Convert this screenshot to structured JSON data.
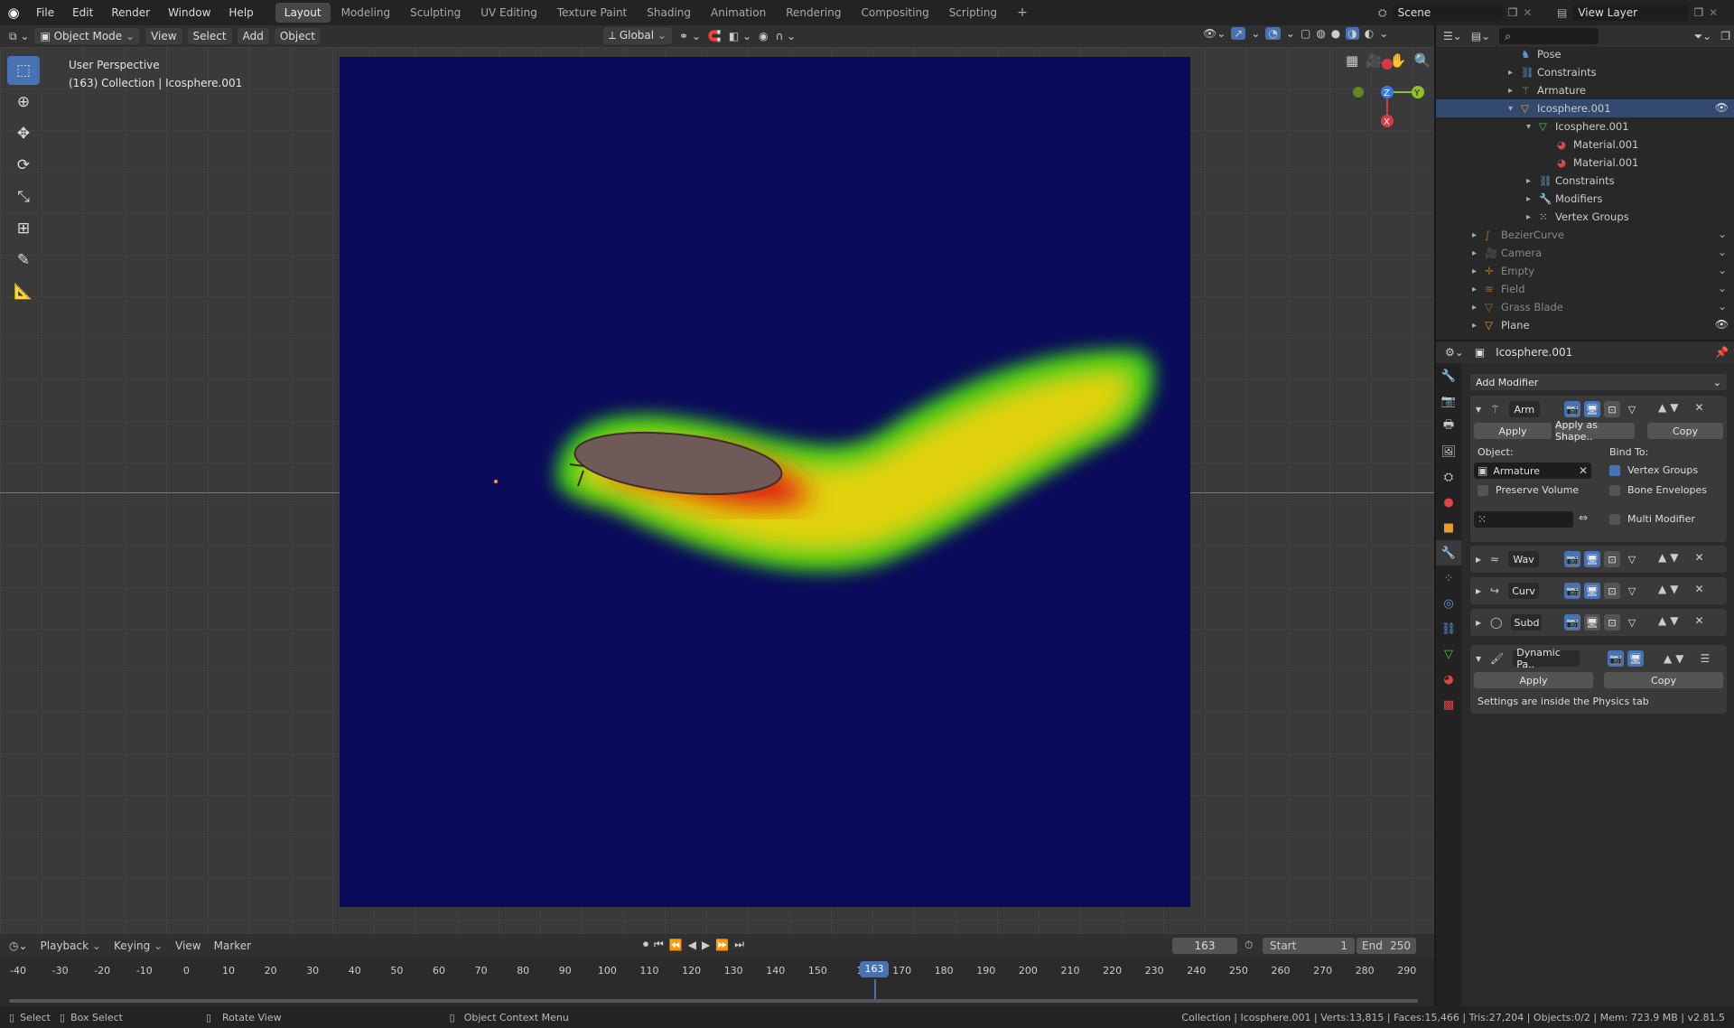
{
  "topbar": {
    "menus": [
      "File",
      "Edit",
      "Render",
      "Window",
      "Help"
    ],
    "workspaces": [
      "Layout",
      "Modeling",
      "Sculpting",
      "UV Editing",
      "Texture Paint",
      "Shading",
      "Animation",
      "Rendering",
      "Compositing",
      "Scripting"
    ],
    "active_workspace": "Layout",
    "add_tab": "+",
    "scene": "Scene",
    "view_layer": "View Layer"
  },
  "viewport_header": {
    "mode": "Object Mode",
    "menus": [
      "View",
      "Select",
      "Add",
      "Object"
    ],
    "orientation": "Global"
  },
  "viewport": {
    "line1": "User Perspective",
    "line2": "(163) Collection | Icosphere.001",
    "canvas_color": "#0a0a5a"
  },
  "outliner": {
    "search_placeholder": "",
    "rows": [
      {
        "label": "Pose",
        "icon": "pose-icon",
        "indent": 1,
        "muted": false
      },
      {
        "label": "Constraints",
        "icon": "constraint-icon",
        "indent": 1,
        "muted": false,
        "exp": "▸"
      },
      {
        "label": "Armature",
        "icon": "armature-icon",
        "indent": 1,
        "muted": false,
        "exp": "▸"
      },
      {
        "label": "Icosphere.001",
        "icon": "mesh-object-icon",
        "indent": 1,
        "muted": false,
        "exp": "▾",
        "highlight": true
      },
      {
        "label": "Icosphere.001",
        "icon": "mesh-data-icon",
        "indent": 2,
        "muted": false,
        "exp": "▾"
      },
      {
        "label": "Material.001",
        "icon": "material-icon",
        "indent": 3,
        "muted": false
      },
      {
        "label": "Material.001",
        "icon": "material-icon",
        "indent": 3,
        "muted": false
      },
      {
        "label": "Constraints",
        "icon": "constraint-icon",
        "indent": 2,
        "muted": false,
        "exp": "▸"
      },
      {
        "label": "Modifiers",
        "icon": "wrench-icon",
        "indent": 2,
        "muted": false,
        "exp": "▸"
      },
      {
        "label": "Vertex Groups",
        "icon": "vertex-groups-icon",
        "indent": 2,
        "muted": false,
        "exp": "▸"
      },
      {
        "label": "BezierCurve",
        "icon": "curve-icon",
        "indent": 0,
        "muted": true,
        "exp": "▸"
      },
      {
        "label": "Camera",
        "icon": "camera-icon",
        "indent": 0,
        "muted": true,
        "exp": "▸"
      },
      {
        "label": "Empty",
        "icon": "empty-icon",
        "indent": 0,
        "muted": true,
        "exp": "▸"
      },
      {
        "label": "Field",
        "icon": "field-icon",
        "indent": 0,
        "muted": true,
        "exp": "▸"
      },
      {
        "label": "Grass Blade",
        "icon": "mesh-object-icon",
        "indent": 0,
        "muted": true,
        "exp": "▸"
      },
      {
        "label": "Plane",
        "icon": "mesh-object-icon",
        "indent": 0,
        "muted": false,
        "exp": "▸"
      }
    ]
  },
  "properties": {
    "object_name": "Icosphere.001",
    "add_modifier": "Add Modifier",
    "armature_mod": {
      "name": "Arm",
      "apply": "Apply",
      "apply_shape": "Apply as Shape..",
      "copy": "Copy",
      "object_label": "Object:",
      "object_value": "Armature",
      "bind_to": "Bind To:",
      "vertex_groups": "Vertex Groups",
      "preserve_volume": "Preserve Volume",
      "bone_envelopes": "Bone Envelopes",
      "multi_modifier": "Multi Modifier"
    },
    "collapsed_mods": [
      {
        "name": "Wav",
        "icon": "wave-icon"
      },
      {
        "name": "Curv",
        "icon": "curve-mod-icon"
      },
      {
        "name": "Subd",
        "icon": "subsurf-icon"
      }
    ],
    "dynpaint": {
      "name": "Dynamic Pa..",
      "apply": "Apply",
      "copy": "Copy",
      "note": "Settings are inside the Physics tab"
    }
  },
  "timeline": {
    "menus": [
      "Playback",
      "Keying",
      "View",
      "Marker"
    ],
    "current_frame": "163",
    "start_label": "Start",
    "start": "1",
    "end_label": "End",
    "end": "250",
    "ticks": [
      "-40",
      "-30",
      "-20",
      "-10",
      "0",
      "10",
      "20",
      "30",
      "40",
      "50",
      "60",
      "70",
      "80",
      "90",
      "100",
      "110",
      "120",
      "130",
      "140",
      "150",
      "1",
      "170",
      "180",
      "190",
      "200",
      "210",
      "220",
      "230",
      "240",
      "250",
      "260",
      "270",
      "280",
      "290"
    ],
    "playhead": "163"
  },
  "status": {
    "select": "Select",
    "box_select": "Box Select",
    "rotate": "Rotate View",
    "context": "Object Context Menu",
    "stats": "Collection | Icosphere.001 | Verts:13,815 | Faces:15,466 | Tris:27,204 | Objects:0/2 | Mem: 723.9 MB | v2.81.5"
  }
}
